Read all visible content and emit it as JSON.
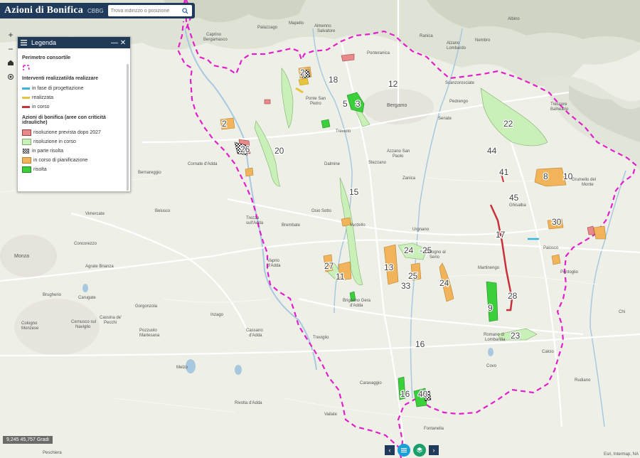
{
  "app": {
    "title": "Azioni di Bonifica",
    "subtitle": "CBBG"
  },
  "search": {
    "placeholder": "Trova indirizzo o posizione"
  },
  "zoom": {
    "in": "+",
    "out": "−"
  },
  "legend": {
    "title": "Legenda",
    "sections": {
      "perimetro": "Perimetro consortile",
      "interventi": "Interventi realizzati/da realizzare",
      "azioni": "Azioni di bonifica (aree con criticità idrauliche)"
    },
    "interventi_items": [
      {
        "label": "in fase di progettazione",
        "color": "#38b6e0"
      },
      {
        "label": "realizzata",
        "color": "#e8c43a"
      },
      {
        "label": "in corso",
        "color": "#c8303a"
      }
    ],
    "azioni_items": [
      {
        "label": "risoluzione prevista dopo 2027",
        "color": "#e88a8a"
      },
      {
        "label": "risoluzione in corso",
        "color": "#c9f0b8"
      },
      {
        "label": "in parte risolta",
        "color": "#888888"
      },
      {
        "label": "in corso di pianificazione",
        "color": "#f2b45a"
      },
      {
        "label": "risolta",
        "color": "#3ccf3c"
      }
    ]
  },
  "coords": "9,245 45,757 Gradi",
  "attribution": "Esri, Intermap, NA",
  "colors": {
    "perimeter": "#e020c8",
    "header": "#1f3a5a"
  },
  "map_labels": {
    "places": [
      "Almenno Salvatore",
      "Ponteranica",
      "Albino",
      "Alzano Lombardo",
      "Nembro",
      "Ranica",
      "Scanzorosciate",
      "Pedrengo",
      "Trescore Balneario",
      "Bergamo",
      "Ponte San Pietro",
      "Curno",
      "Seriate",
      "Treviolo",
      "Grumello del Monte",
      "Azzano San Paolo",
      "Zanica",
      "Dalmine",
      "Stezzano",
      "Osio Sotto",
      "Verdello",
      "Urgnano",
      "Ghisalba",
      "Cologno al Serio",
      "Martinengo",
      "Pelosco",
      "Palosco",
      "Pontoglio",
      "Chiari",
      "Romano di Lombardia",
      "Covo",
      "Calcio",
      "Rudiano",
      "Fontanella",
      "Caravaggio",
      "Treviglio",
      "Brignano Gera d'Adda",
      "Cassano d'Adda",
      "Vaprio d'Adda",
      "Trezzo sull'Adda",
      "Brembate",
      "Capriate",
      "Monza",
      "Concorezzo",
      "Vimercate",
      "Agrate Brianza",
      "Brugherio",
      "Carugate",
      "Gorgonzola",
      "Inzago",
      "Melzo",
      "Pozzuolo Martesana",
      "Cassina de' Pecchi",
      "Cologno Monzese",
      "Rivolta d'Adda",
      "Peschiera Borromeo",
      "Bernareggio",
      "Belusco",
      "Cornate d'Adda",
      "Caprino Bergamasco",
      "Palazzago",
      "Mapello",
      "Ponte San Pietro"
    ],
    "areas": [
      "2",
      "3",
      "5",
      "8",
      "9",
      "10",
      "11",
      "12",
      "13",
      "16",
      "16",
      "17",
      "18",
      "20",
      "22",
      "23",
      "24",
      "24",
      "25",
      "25",
      "26",
      "27",
      "28",
      "30",
      "33",
      "40",
      "41",
      "44",
      "45"
    ]
  }
}
